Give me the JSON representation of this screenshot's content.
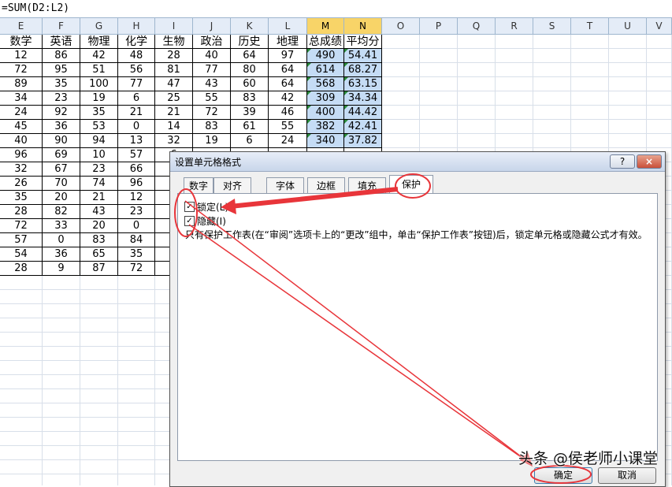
{
  "formula_bar": {
    "text": "=SUM(D2:L2)"
  },
  "columns": [
    "E",
    "F",
    "G",
    "H",
    "I",
    "J",
    "K",
    "L",
    "M",
    "N",
    "O",
    "P",
    "Q",
    "R",
    "S",
    "T",
    "U",
    "V"
  ],
  "headers": [
    "数学",
    "英语",
    "物理",
    "化学",
    "生物",
    "政治",
    "历史",
    "地理",
    "总成绩",
    "平均分"
  ],
  "rows": [
    [
      "12",
      "86",
      "42",
      "48",
      "28",
      "40",
      "64",
      "97",
      "490",
      "54.41"
    ],
    [
      "72",
      "95",
      "51",
      "56",
      "81",
      "77",
      "80",
      "64",
      "614",
      "68.27"
    ],
    [
      "89",
      "35",
      "100",
      "77",
      "47",
      "43",
      "60",
      "64",
      "568",
      "63.15"
    ],
    [
      "34",
      "23",
      "19",
      "6",
      "25",
      "55",
      "83",
      "42",
      "309",
      "34.34"
    ],
    [
      "24",
      "92",
      "35",
      "21",
      "21",
      "72",
      "39",
      "46",
      "400",
      "44.42"
    ],
    [
      "45",
      "36",
      "53",
      "0",
      "14",
      "83",
      "61",
      "55",
      "382",
      "42.41"
    ],
    [
      "40",
      "90",
      "94",
      "13",
      "32",
      "19",
      "6",
      "24",
      "340",
      "37.82"
    ],
    [
      "96",
      "69",
      "10",
      "57",
      "6"
    ],
    [
      "32",
      "67",
      "23",
      "66",
      "2"
    ],
    [
      "26",
      "70",
      "74",
      "96"
    ],
    [
      "35",
      "20",
      "21",
      "12"
    ],
    [
      "28",
      "82",
      "43",
      "23",
      "4"
    ],
    [
      "72",
      "33",
      "20",
      "0",
      "4"
    ],
    [
      "57",
      "0",
      "83",
      "84",
      "9"
    ],
    [
      "54",
      "36",
      "65",
      "35",
      "5"
    ],
    [
      "28",
      "9",
      "87",
      "72",
      "7"
    ]
  ],
  "dialog": {
    "title": "设置单元格格式",
    "help": "?",
    "close": "×",
    "tabs": [
      "数字",
      "对齐",
      "字体",
      "边框",
      "填充",
      "保护"
    ],
    "active_tab": "保护",
    "locked_label": "锁定(L)",
    "hidden_label": "隐藏(I)",
    "locked_checked": true,
    "hidden_checked": true,
    "description": "只有保护工作表(在“审阅”选项卡上的“更改”组中，单击“保护工作表”按钮)后，锁定单元格或隐藏公式才有效。",
    "ok": "确定",
    "cancel": "取消"
  },
  "watermark": "头条 @侯老师小课堂",
  "colors": {
    "annotation": "#e8353a",
    "selected_col": "#f8d468",
    "selected_cell": "#c5dcf5"
  }
}
